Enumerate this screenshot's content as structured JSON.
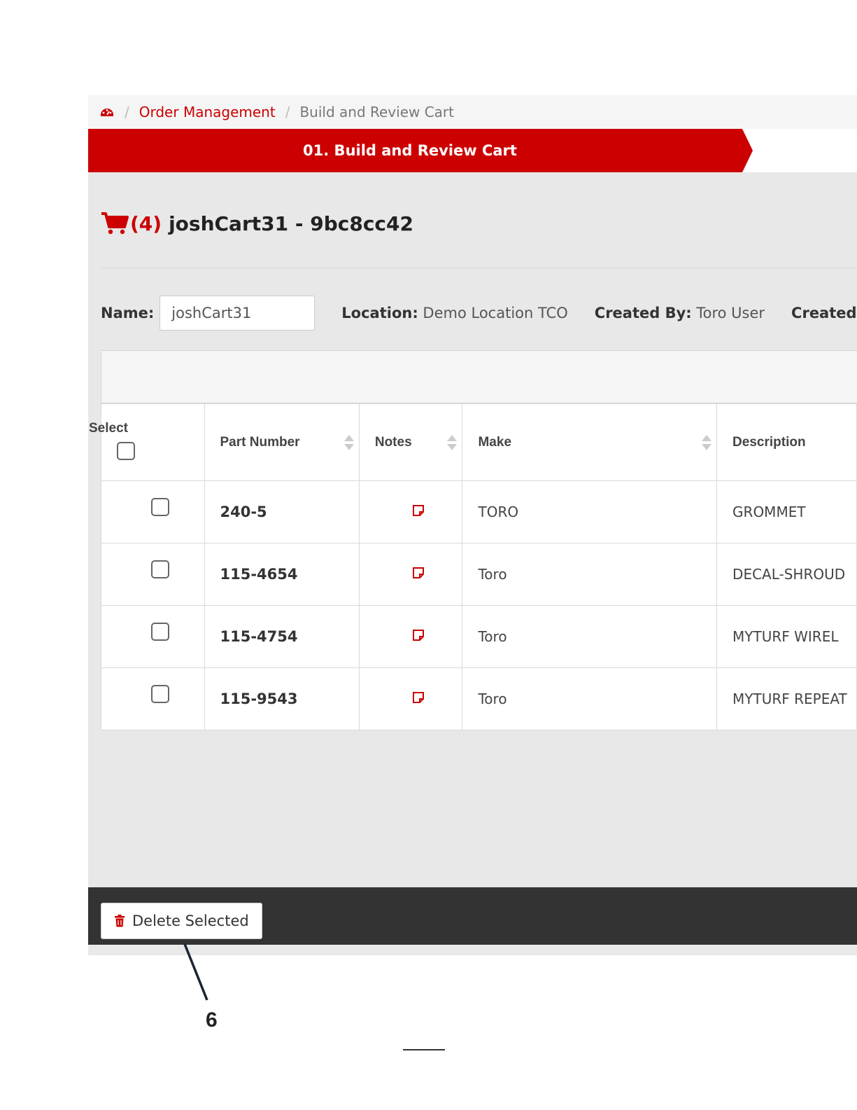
{
  "breadcrumb": {
    "home_icon": "dashboard-icon",
    "separator": "/",
    "link": "Order Management",
    "current": "Build and Review Cart"
  },
  "steps": {
    "active_label": "01. Build and Review Cart"
  },
  "cart": {
    "icon": "shopping-cart-icon",
    "count": "(4)",
    "title": "joshCart31 - 9bc8cc42"
  },
  "meta": {
    "name_label": "Name:",
    "name_value": "joshCart31",
    "location_label": "Location:",
    "location_value": "Demo Location TCO",
    "created_by_label": "Created By:",
    "created_by_value": "Toro User",
    "created_label": "Created"
  },
  "table": {
    "headers": {
      "select": "Select",
      "part_number": "Part Number",
      "notes": "Notes",
      "make": "Make",
      "description": "Description"
    },
    "rows": [
      {
        "part_number": "240-5",
        "make": "TORO",
        "description": "GROMMET"
      },
      {
        "part_number": "115-4654",
        "make": "Toro",
        "description": "DECAL-SHROUD"
      },
      {
        "part_number": "115-4754",
        "make": "Toro",
        "description": "MYTURF WIREL"
      },
      {
        "part_number": "115-9543",
        "make": "Toro",
        "description": "MYTURF REPEAT"
      }
    ]
  },
  "footer": {
    "delete_label": "Delete Selected",
    "delete_icon": "trash-icon"
  },
  "annotation": {
    "callout_number": "6"
  },
  "colors": {
    "brand_red": "#cc0000",
    "footer_dark": "#333333"
  }
}
